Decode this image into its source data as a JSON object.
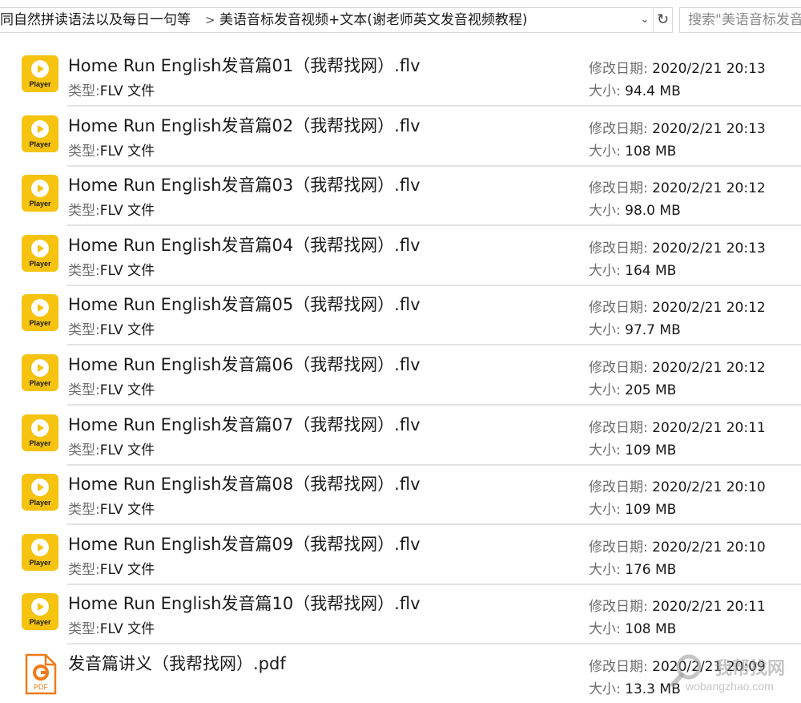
{
  "address_bar": {
    "crumbs": [
      "同自然拼读语法以及每日一句等",
      "美语音标发音视频+文本(谢老师英文发音视频教程)"
    ],
    "separator": ">",
    "search_placeholder": "搜索\"美语音标发音"
  },
  "labels": {
    "type": "类型:",
    "modified": "修改日期:",
    "size": "大小:"
  },
  "icons": {
    "flv_text": "Player",
    "pdf_text": "PDF"
  },
  "colors": {
    "flv_icon": "#f5c310",
    "pdf_icon": "#f07a1a"
  },
  "files": [
    {
      "name": "Home Run English发音篇01（我帮找网）.flv",
      "type": "FLV 文件",
      "modified": "2020/2/21 20:13",
      "size": "94.4 MB",
      "kind": "flv"
    },
    {
      "name": "Home Run English发音篇02（我帮找网）.flv",
      "type": "FLV 文件",
      "modified": "2020/2/21 20:13",
      "size": "108 MB",
      "kind": "flv"
    },
    {
      "name": "Home Run English发音篇03（我帮找网）.flv",
      "type": "FLV 文件",
      "modified": "2020/2/21 20:12",
      "size": "98.0 MB",
      "kind": "flv"
    },
    {
      "name": "Home Run English发音篇04（我帮找网）.flv",
      "type": "FLV 文件",
      "modified": "2020/2/21 20:13",
      "size": "164 MB",
      "kind": "flv"
    },
    {
      "name": "Home Run English发音篇05（我帮找网）.flv",
      "type": "FLV 文件",
      "modified": "2020/2/21 20:12",
      "size": "97.7 MB",
      "kind": "flv"
    },
    {
      "name": "Home Run English发音篇06（我帮找网）.flv",
      "type": "FLV 文件",
      "modified": "2020/2/21 20:12",
      "size": "205 MB",
      "kind": "flv"
    },
    {
      "name": "Home Run English发音篇07（我帮找网）.flv",
      "type": "FLV 文件",
      "modified": "2020/2/21 20:11",
      "size": "109 MB",
      "kind": "flv"
    },
    {
      "name": "Home Run English发音篇08（我帮找网）.flv",
      "type": "FLV 文件",
      "modified": "2020/2/21 20:10",
      "size": "109 MB",
      "kind": "flv"
    },
    {
      "name": "Home Run English发音篇09（我帮找网）.flv",
      "type": "FLV 文件",
      "modified": "2020/2/21 20:10",
      "size": "176 MB",
      "kind": "flv"
    },
    {
      "name": "Home Run English发音篇10（我帮找网）.flv",
      "type": "FLV 文件",
      "modified": "2020/2/21 20:11",
      "size": "108 MB",
      "kind": "flv"
    },
    {
      "name": "发音篇讲义（我帮找网）.pdf",
      "type": "",
      "modified": "2020/2/21 20:09",
      "size": "13.3 MB",
      "kind": "pdf"
    }
  ],
  "watermark": {
    "text": "我帮找网",
    "sub": "wobangzhao.com"
  }
}
